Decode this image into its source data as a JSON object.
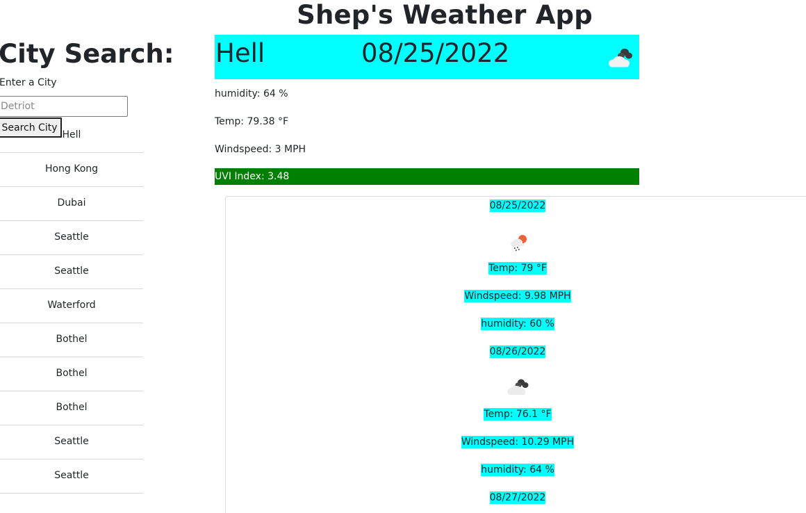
{
  "app": {
    "title": "Shep's Weather App"
  },
  "search": {
    "heading": "City Search:",
    "label": "Enter a City",
    "placeholder": "Detriot",
    "button_label": "Search City"
  },
  "history": [
    "Hell",
    "Hong Kong",
    "Dubai",
    "Seattle",
    "Seattle",
    "Waterford",
    "Bothel",
    "Bothel",
    "Bothel",
    "Seattle",
    "Seattle"
  ],
  "current": {
    "city": "Hell",
    "date": "08/25/2022",
    "icon": "cloudy-icon",
    "humidity": "humidity: 64 %",
    "temp": "Temp: 79.38 °F",
    "wind": "Windspeed: 3 MPH",
    "uvi": "UVI Index: 3.48",
    "uvi_color": "#008000",
    "accent_color": "#00ffff"
  },
  "forecast": [
    {
      "date": "08/25/2022",
      "icon": "sun-rain-cloud-icon",
      "temp": "Temp: 79 °F",
      "wind": "Windspeed: 9.98 MPH",
      "humidity": "humidity: 60 %"
    },
    {
      "date": "08/26/2022",
      "icon": "cloudy-icon",
      "temp": "Temp: 76.1 °F",
      "wind": "Windspeed: 10.29 MPH",
      "humidity": "humidity: 64 %"
    },
    {
      "date": "08/27/2022"
    }
  ]
}
